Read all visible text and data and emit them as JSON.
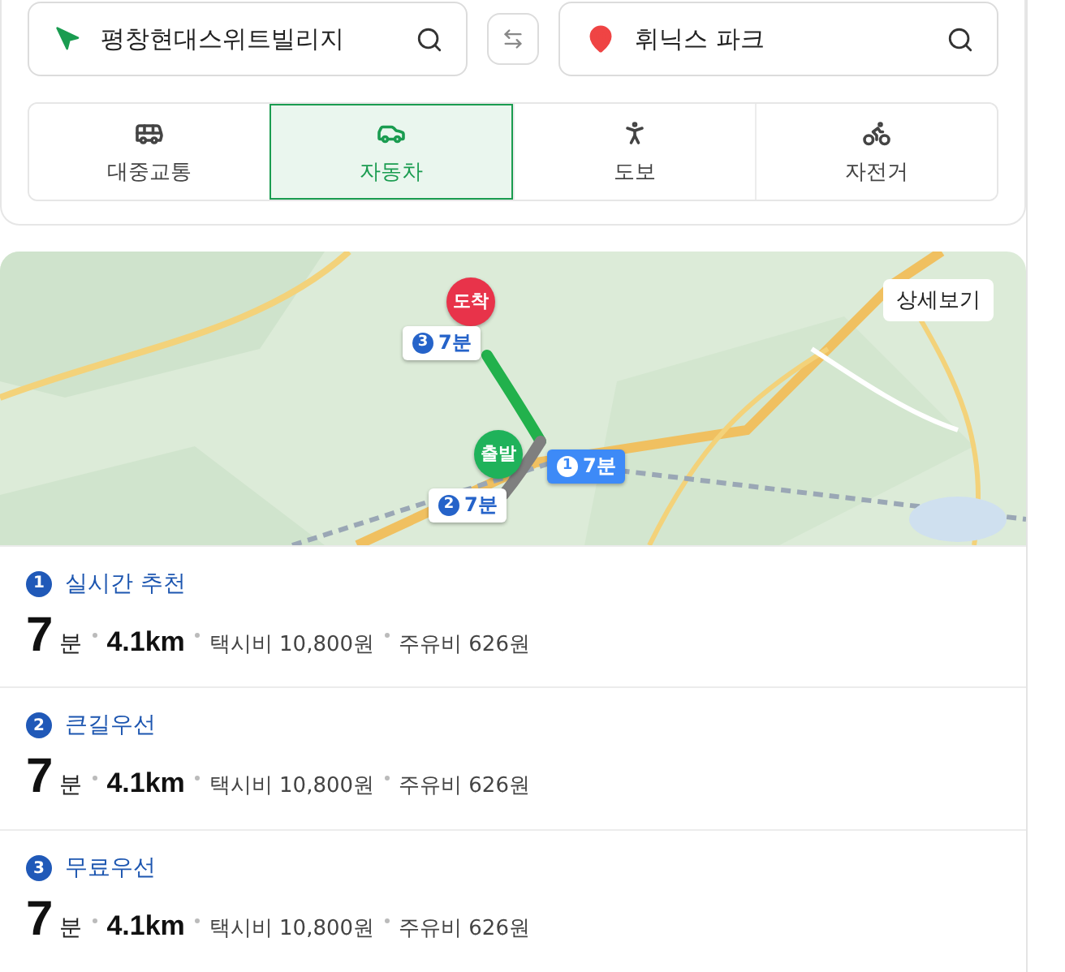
{
  "origin": {
    "value": "평창현대스위트빌리지"
  },
  "destination": {
    "value": "휘닉스 파크"
  },
  "modes": [
    {
      "kind": "transit",
      "label": "대중교통",
      "selected": false
    },
    {
      "kind": "car",
      "label": "자동차",
      "selected": true
    },
    {
      "kind": "walk",
      "label": "도보",
      "selected": false
    },
    {
      "kind": "bike",
      "label": "자전거",
      "selected": false
    }
  ],
  "map": {
    "kind": "picture",
    "detail_button": "상세보기",
    "end_marker": "도착",
    "start_marker": "출발",
    "route_badges": [
      {
        "number": "3",
        "time": "7분",
        "selected": false
      },
      {
        "number": "1",
        "time": "7분",
        "selected": true
      },
      {
        "number": "2",
        "time": "7분",
        "selected": false
      }
    ]
  },
  "routes": [
    {
      "number": "1",
      "name": "실시간 추천",
      "minutes": "7",
      "minute_unit": "분",
      "distance": "4.1km",
      "taxi": "택시비 10,800원",
      "fuel": "주유비 626원"
    },
    {
      "number": "2",
      "name": "큰길우선",
      "minutes": "7",
      "minute_unit": "분",
      "distance": "4.1km",
      "taxi": "택시비 10,800원",
      "fuel": "주유비 626원"
    },
    {
      "number": "3",
      "name": "무료우선",
      "minutes": "7",
      "minute_unit": "분",
      "distance": "4.1km",
      "taxi": "택시비 10,800원",
      "fuel": "주유비 626원"
    }
  ]
}
